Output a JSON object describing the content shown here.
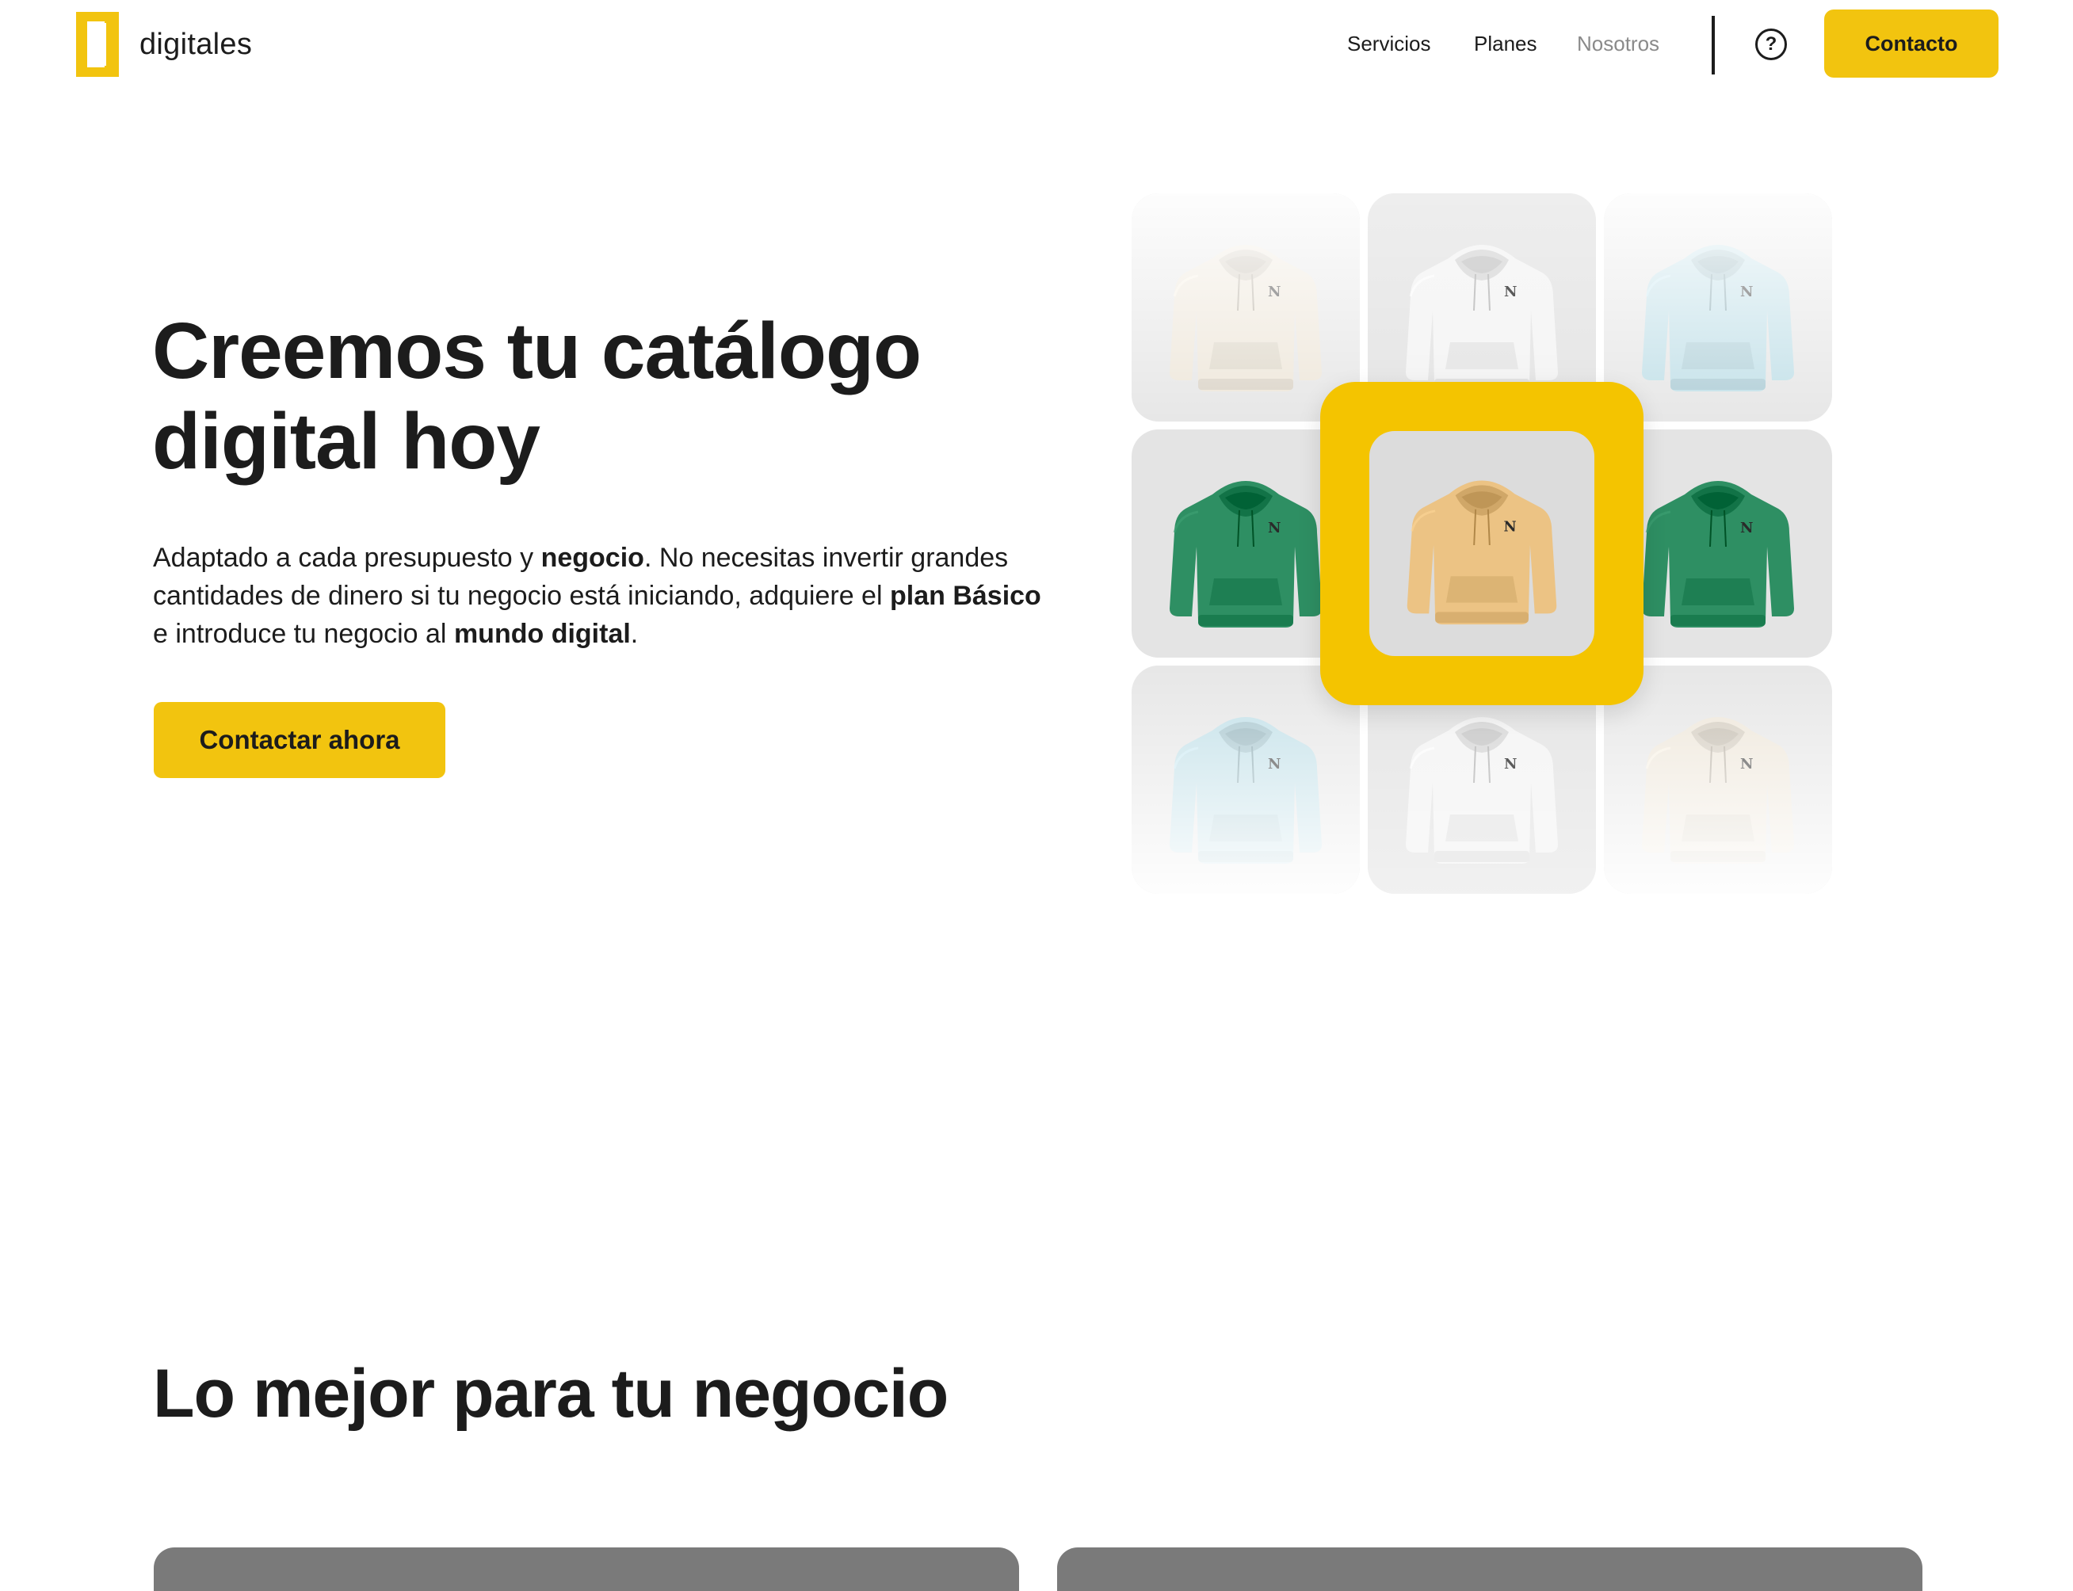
{
  "header": {
    "logo_text": "digitales",
    "nav": [
      {
        "label": "Servicios"
      },
      {
        "label": "Planes"
      },
      {
        "label": "Nosotros"
      }
    ],
    "help_icon": "question-circle-icon",
    "contact_label": "Contacto"
  },
  "hero": {
    "title_line1": "Creemos tu catálogo",
    "title_line2": "digital hoy",
    "desc": {
      "p1": "Adaptado a cada presupuesto y ",
      "b1": "negocio",
      "p2": ". No necesitas invertir grandes cantidades de dinero si tu negocio está iniciando, adquiere el ",
      "b2": "plan Básico",
      "p3": " e introduce tu negocio al ",
      "b3": "mundo digital",
      "p4": "."
    },
    "cta_label": "Contactar ahora"
  },
  "catalog": {
    "products": [
      {
        "name": "hoodie-cream",
        "color": "#ece4d6"
      },
      {
        "name": "hoodie-white",
        "color": "#f4f4f4"
      },
      {
        "name": "hoodie-light-blue",
        "color": "#bcdde6"
      },
      {
        "name": "hoodie-green",
        "color": "#2e8f63"
      },
      {
        "name": "hoodie-tan-featured",
        "color": "#ecc384"
      },
      {
        "name": "hoodie-green",
        "color": "#2e8f63"
      },
      {
        "name": "hoodie-light-blue",
        "color": "#bcdde6"
      },
      {
        "name": "hoodie-white",
        "color": "#f4f4f4"
      },
      {
        "name": "hoodie-cream",
        "color": "#ece4d6"
      }
    ],
    "featured_frame_color": "#f4c400"
  },
  "section2": {
    "title": "Lo mejor para tu negocio"
  },
  "colors": {
    "accent": "#f2c40f",
    "text": "#1c1c1c",
    "nav_muted": "#8a8a8a",
    "card": "#7a7a7a"
  }
}
